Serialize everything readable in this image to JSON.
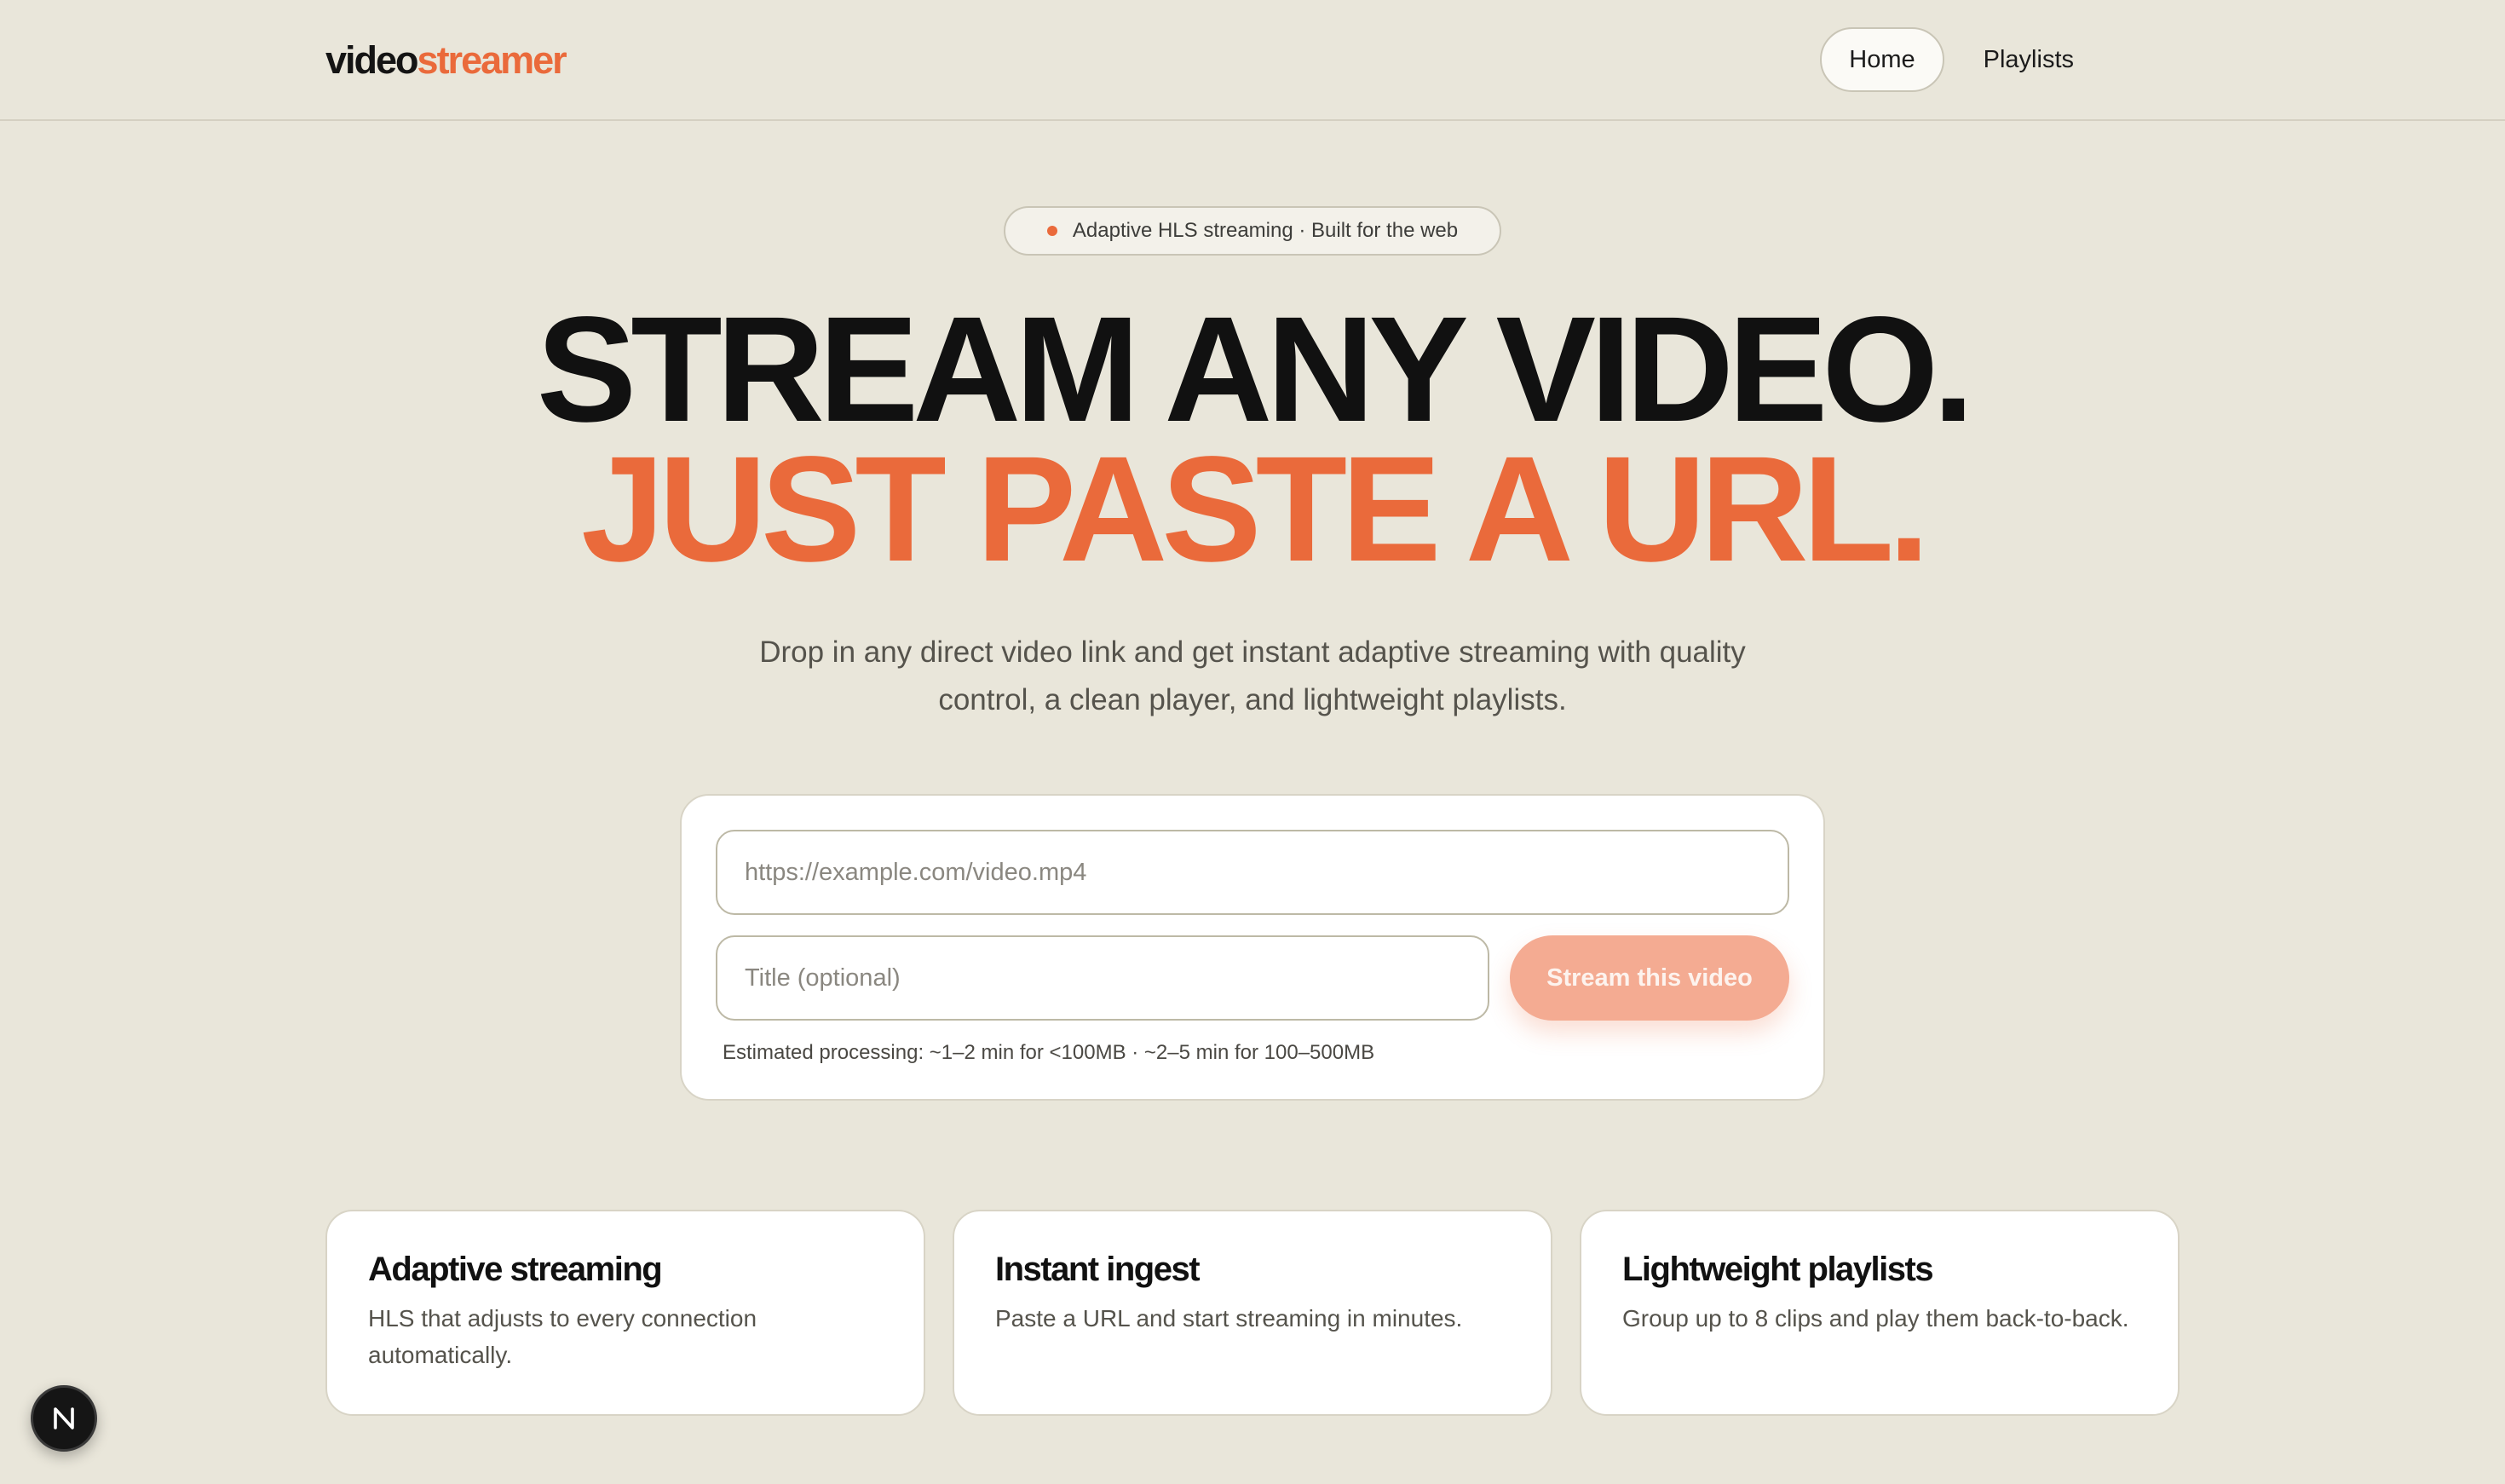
{
  "header": {
    "logo_part1": "video",
    "logo_part2": "streamer",
    "nav": [
      {
        "label": "Home",
        "active": true
      },
      {
        "label": "Playlists",
        "active": false
      }
    ]
  },
  "hero": {
    "badge": "Adaptive HLS streaming · Built for the web",
    "headline_line1": "STREAM ANY VIDEO.",
    "headline_line2": "JUST PASTE A URL.",
    "subtitle": "Drop in any direct video link and get instant adaptive streaming with quality control, a clean player, and lightweight playlists."
  },
  "form": {
    "url_placeholder": "https://example.com/video.mp4",
    "url_value": "",
    "title_placeholder": "Title (optional)",
    "title_value": "",
    "submit_label": "Stream this video",
    "estimate": "Estimated processing: ~1–2 min for <100MB · ~2–5 min for 100–500MB"
  },
  "features": [
    {
      "title": "Adaptive streaming",
      "description": "HLS that adjusts to every connection automatically."
    },
    {
      "title": "Instant ingest",
      "description": "Paste a URL and start streaming in minutes."
    },
    {
      "title": "Lightweight playlists",
      "description": "Group up to 8 clips and play them back-to-back."
    }
  ],
  "colors": {
    "accent": "#ea6a3b",
    "background": "#e9e6da",
    "button_disabled": "#f4ab92"
  },
  "icons": {
    "dev_badge": "next-logo-icon",
    "badge_dot": "status-dot-icon"
  }
}
